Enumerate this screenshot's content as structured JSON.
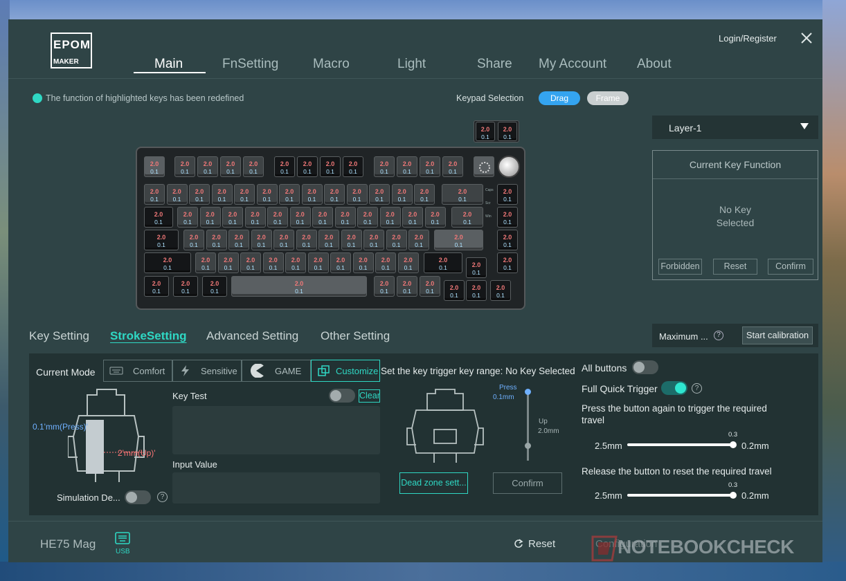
{
  "nav": {
    "items": [
      "Main",
      "FnSetting",
      "Macro",
      "Light",
      "Share",
      "My Account",
      "About"
    ],
    "active": "Main",
    "login": "Login/Register"
  },
  "brand": {
    "logo_text": "EPOMAKER"
  },
  "hint": {
    "text": "The function of highlighted keys has been redefined",
    "dot_color": "#2fd8c4"
  },
  "keypad": {
    "label": "Keypad Selection",
    "drag": "Drag",
    "frame": "Frame"
  },
  "keyboard": {
    "key_top": "2.0",
    "key_bottom": "0.1",
    "side_labels": [
      "Caps",
      "Scr",
      "Win"
    ]
  },
  "layer": {
    "selected": "Layer-1"
  },
  "current_key": {
    "title": "Current Key Function",
    "empty_line1": "No Key",
    "empty_line2": "Selected",
    "forbidden": "Forbidden",
    "reset": "Reset",
    "confirm": "Confirm"
  },
  "tabs": [
    "Key Setting",
    "StrokeSetting",
    "Advanced Setting",
    "Other Setting"
  ],
  "calibration": {
    "label": "Maximum ...",
    "button": "Start calibration"
  },
  "stroke": {
    "current_mode_label": "Current Mode",
    "modes": [
      "Comfort",
      "Sensitive",
      "GAME",
      "Customize"
    ],
    "active_mode": "Customize",
    "press_label": "0.1'mm(Press)'",
    "up_label": "2'mm(Up)'",
    "simulation_label": "Simulation De...",
    "key_test_label": "Key Test",
    "clear": "Clear",
    "input_value_label": "Input Value",
    "range_title": "Set the key trigger key range: No Key Selected",
    "press_mini": "Press",
    "press_val": "0.1mm",
    "up_mini": "Up",
    "up_val": "2.0mm",
    "dead_zone": "Dead zone sett...",
    "confirm": "Confirm",
    "all_buttons": "All buttons",
    "full_quick_trigger": "Full Quick Trigger",
    "press_desc": "Press the button again to trigger the required travel",
    "release_desc": "Release the button to reset the required travel",
    "slider1": {
      "min": "2.5mm",
      "max": "0.2mm",
      "value": "0.3"
    },
    "slider2": {
      "min": "2.5mm",
      "max": "0.2mm",
      "value": "0.3"
    }
  },
  "footer": {
    "model": "HE75 Mag",
    "usb": "USB",
    "reset": "Reset",
    "ghost": "Configuration",
    "watermark": "NOTEBOOKCHECK"
  }
}
